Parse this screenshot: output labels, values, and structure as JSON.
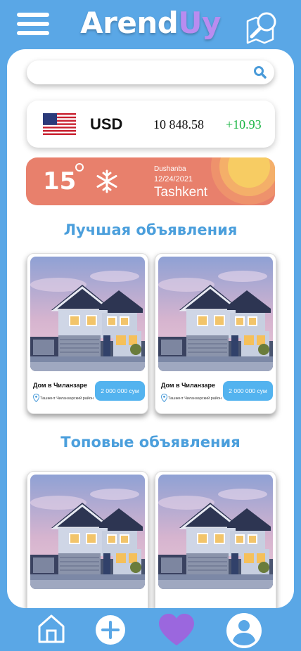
{
  "app": {
    "logo_part1": "Arend",
    "logo_part2": "Uy"
  },
  "header": {
    "menu_icon": "hamburger-menu-icon",
    "map_icon": "map-search-icon"
  },
  "search": {
    "value": "",
    "placeholder": "",
    "icon": "search-icon"
  },
  "currency": {
    "code": "USD",
    "value": "10 848.58",
    "change": "+10.93",
    "flag": "us-flag-icon",
    "change_color": "#16b340"
  },
  "weather": {
    "temperature": "15",
    "icon": "snowflake-icon",
    "day": "Dushanba",
    "date": "12/24/2021",
    "city": "Tashkent",
    "background": "#e8806c"
  },
  "sections": {
    "best": {
      "title": "Лучшая объявления",
      "cards": [
        {
          "title": "Дом в Чиланзаре",
          "price": "2 000 000 сум",
          "address": "Ташкент Чиланзарский район"
        },
        {
          "title": "Дом в Чиланзаре",
          "price": "2 000 000 сум",
          "address": "Ташкент Чиланзарский район"
        }
      ]
    },
    "top": {
      "title": "Топовые объявления",
      "cards": [
        {},
        {}
      ]
    }
  },
  "bottom_nav": {
    "items": [
      {
        "name": "home",
        "icon": "home-icon"
      },
      {
        "name": "add",
        "icon": "plus-icon"
      },
      {
        "name": "favorites",
        "icon": "heart-icon"
      },
      {
        "name": "profile",
        "icon": "user-icon"
      }
    ]
  },
  "colors": {
    "brand_blue": "#5aa7e6",
    "accent_purple": "#b98cf0",
    "price_badge": "#53b3ef",
    "section_title": "#4b9fdc"
  }
}
